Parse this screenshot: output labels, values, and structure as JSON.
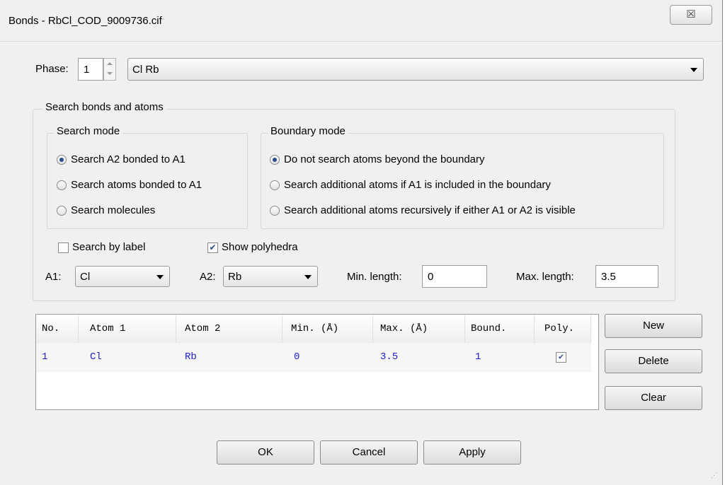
{
  "window": {
    "title": "Bonds - RbCl_COD_9009736.cif",
    "close_label": "☒"
  },
  "phase": {
    "label": "Phase:",
    "number": "1",
    "selected": "Cl Rb"
  },
  "search_group": {
    "title": "Search bonds and atoms"
  },
  "search_mode": {
    "title": "Search mode",
    "options": [
      "Search A2 bonded to A1",
      "Search atoms bonded to A1",
      "Search molecules"
    ],
    "selected_index": 0
  },
  "boundary_mode": {
    "title": "Boundary mode",
    "options": [
      "Do not search atoms beyond the boundary",
      "Search additional atoms if A1 is included in the boundary",
      "Search additional atoms recursively if either A1 or A2 is visible"
    ],
    "selected_index": 0
  },
  "checkboxes": {
    "search_by_label": {
      "label": "Search by label",
      "checked": false
    },
    "show_polyhedra": {
      "label": "Show polyhedra",
      "checked": true
    }
  },
  "atoms": {
    "a1_label": "A1:",
    "a1_value": "Cl",
    "a2_label": "A2:",
    "a2_value": "Rb",
    "min_label": "Min. length:",
    "min_value": "0",
    "max_label": "Max. length:",
    "max_value": "3.5"
  },
  "table": {
    "headers": [
      "No.",
      "Atom 1",
      "Atom 2",
      "Min. (Å)",
      "Max. (Å)",
      "Bound.",
      "Poly."
    ],
    "rows": [
      {
        "no": "1",
        "atom1": "Cl",
        "atom2": "Rb",
        "min": "0",
        "max": "3.5",
        "bound": "1",
        "poly": true
      }
    ]
  },
  "side_buttons": {
    "new": "New",
    "delete": "Delete",
    "clear": "Clear"
  },
  "footer_buttons": {
    "ok": "OK",
    "cancel": "Cancel",
    "apply": "Apply"
  },
  "colors": {
    "table_text": "#1c1ccc",
    "window_bg": "#f0f0f0"
  }
}
